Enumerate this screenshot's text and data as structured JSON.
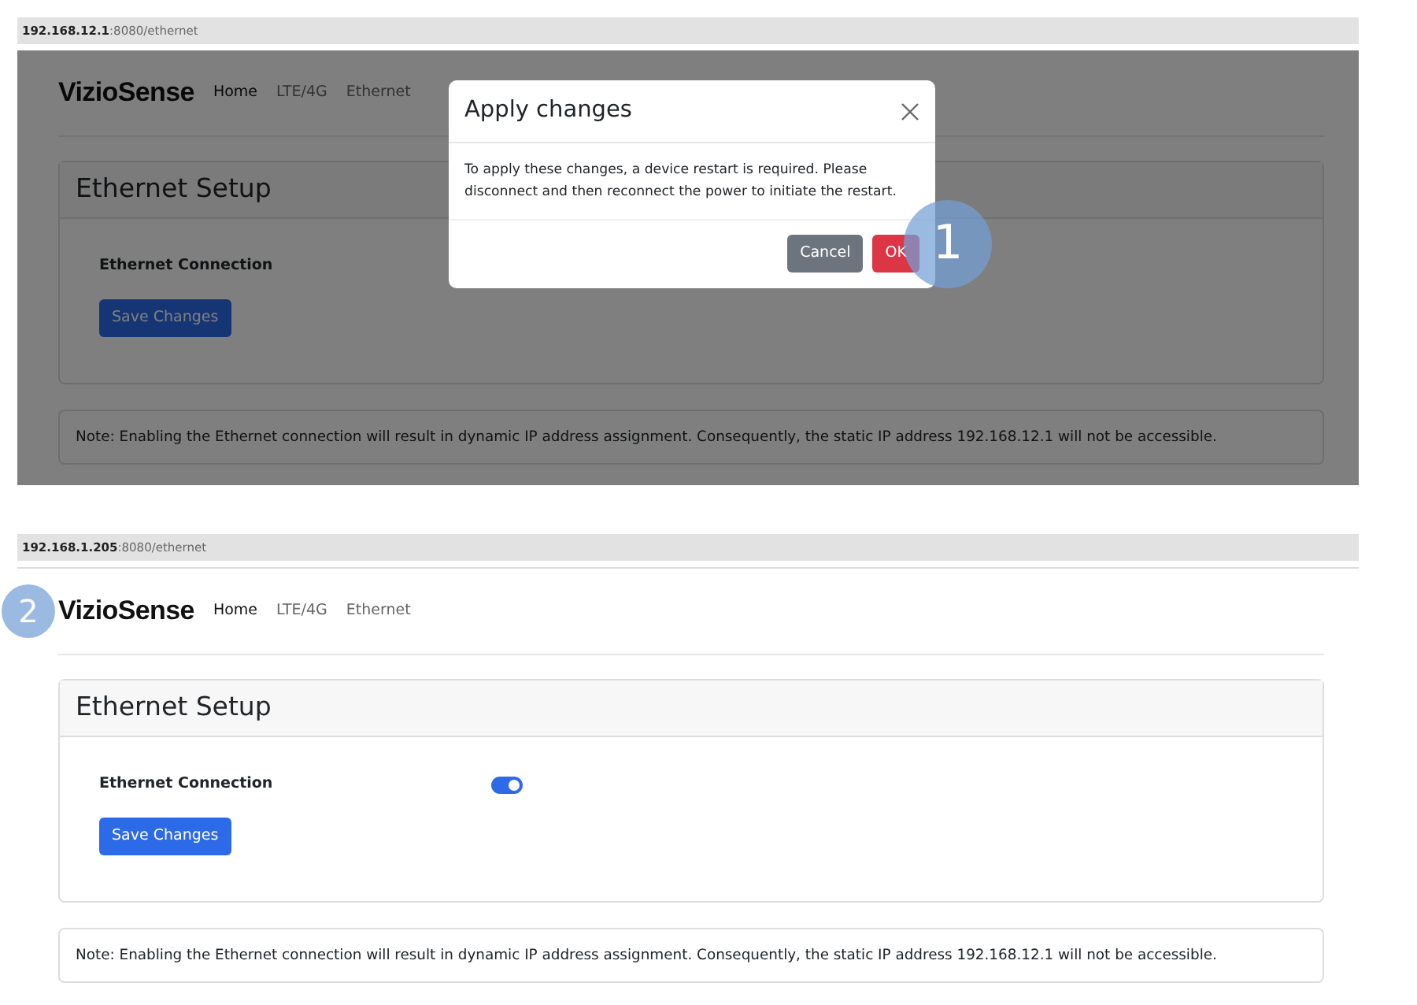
{
  "screenshots": [
    {
      "address": "**192.168.12.1**:8080/ethernet",
      "dimmed": true,
      "step": "1",
      "logo": "VizioSense",
      "nav": [
        {
          "label": "Home",
          "selected": true
        },
        {
          "label": "LTE/4G",
          "selected": false
        },
        {
          "label": "Ethernet",
          "selected": false
        }
      ],
      "card": {
        "title": "Ethernet Setup",
        "field_label": "Ethernet Connection",
        "button": "Save Changes"
      },
      "note": "Note: Enabling the Ethernet connection will result in dynamic IP address assignment. Consequently, the static IP address 192.168.12.1 will not be accessible.",
      "modal": {
        "title": "Apply changes",
        "body": "To apply these changes, a device restart is required. Please disconnect and then reconnect the power to initiate the restart.",
        "buttons": [
          {
            "label": "Cancel",
            "kind": "secondary"
          },
          {
            "label": "OK",
            "kind": "danger"
          }
        ]
      }
    },
    {
      "address": "**192.168.1.205**:8080/ethernet",
      "dimmed": false,
      "step": "2",
      "logo": "VizioSense",
      "nav": [
        {
          "label": "Home",
          "selected": true
        },
        {
          "label": "LTE/4G",
          "selected": false
        },
        {
          "label": "Ethernet",
          "selected": false
        }
      ],
      "card": {
        "title": "Ethernet Setup",
        "field_label": "Ethernet Connection",
        "toggle_on": true,
        "button": "Save Changes"
      },
      "note": "Note: Enabling the Ethernet connection will result in dynamic IP address assignment. Consequently, the static IP address 192.168.12.1 will not be accessible."
    }
  ]
}
